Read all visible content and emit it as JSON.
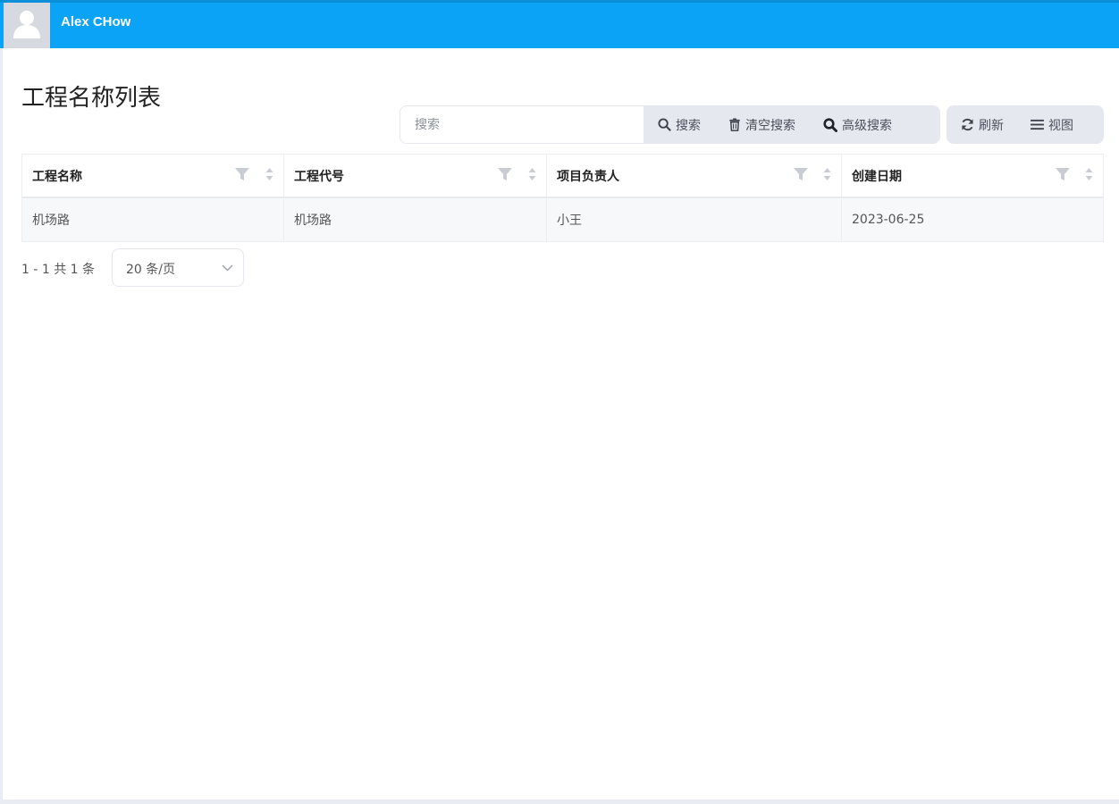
{
  "header": {
    "user_name": "Alex CHow"
  },
  "page": {
    "title": "工程名称列表"
  },
  "toolbar": {
    "search_placeholder": "搜索",
    "search_label": "搜索",
    "clear_label": "清空搜索",
    "advanced_label": "高级搜索",
    "refresh_label": "刷新",
    "view_label": "视图"
  },
  "table": {
    "columns": [
      "工程名称",
      "工程代号",
      "项目负责人",
      "创建日期"
    ],
    "rows": [
      [
        "机场路",
        "机场路",
        "小王",
        "2023-06-25"
      ]
    ]
  },
  "pagination": {
    "summary": "1 - 1 共 1 条",
    "page_size": "20 条/页"
  },
  "colors": {
    "header_bg": "#0aa3f5",
    "toolbar_bg": "#e6e8ef"
  }
}
